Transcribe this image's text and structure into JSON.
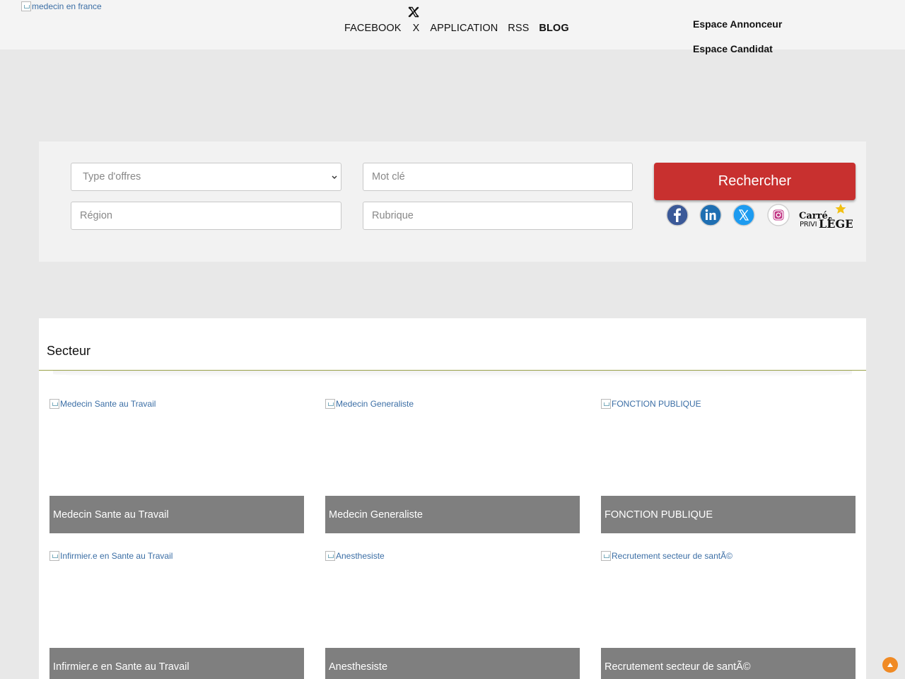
{
  "header": {
    "logo_alt": "medecin en france",
    "nav": [
      "FACEBOOK",
      "X",
      "APPLICATION",
      "RSS",
      "BLOG"
    ],
    "espace_annonceur": "Espace Annonceur",
    "espace_candidat": "Espace Candidat"
  },
  "search": {
    "type_offres_placeholder": "Type d'offres",
    "mot_cle_placeholder": "Mot clé",
    "region_placeholder": "Région",
    "rubrique_placeholder": "Rubrique",
    "button_label": "Rechercher",
    "social_icons": [
      "facebook-icon",
      "linkedin-icon",
      "x-icon",
      "instagram-icon"
    ],
    "carre_privilege_logo": "Carré PRIVILÈGE",
    "accent_color": "#c8302f"
  },
  "secteur": {
    "title": "Secteur",
    "cards": [
      {
        "img_alt": "Medecin Sante au Travail",
        "caption": "Medecin Sante au Travail"
      },
      {
        "img_alt": "Medecin Generaliste",
        "caption": "Medecin Generaliste"
      },
      {
        "img_alt": "FONCTION PUBLIQUE",
        "caption": "FONCTION PUBLIQUE"
      },
      {
        "img_alt": "Infirmier.e en Sante au Travail",
        "caption": "Infirmier.e en Sante au Travail"
      },
      {
        "img_alt": "Anesthesiste",
        "caption": "Anesthesiste"
      },
      {
        "img_alt": "Recrutement secteur de santÃ©",
        "caption": "Recrutement secteur de santÃ©"
      }
    ]
  }
}
